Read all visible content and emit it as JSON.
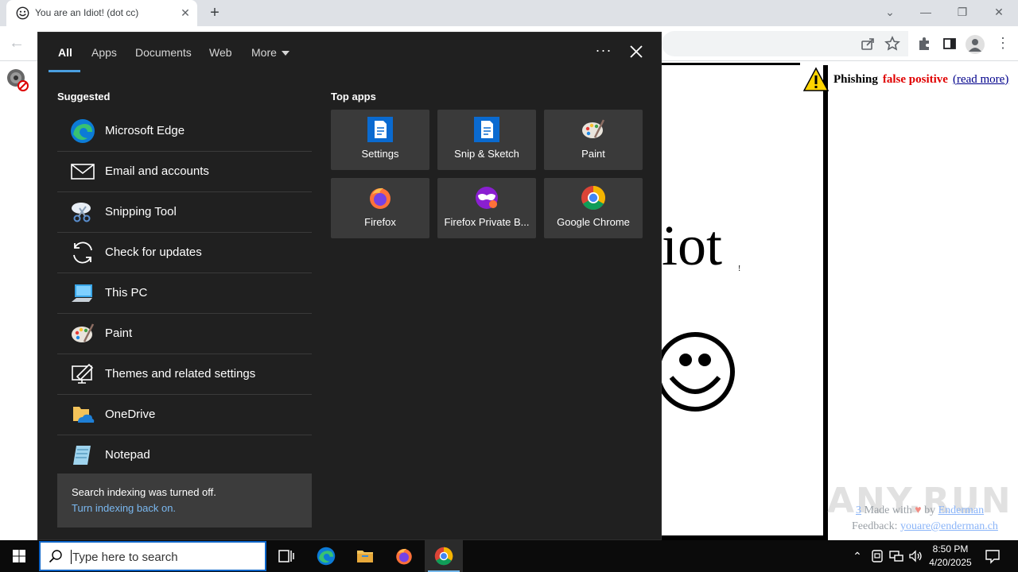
{
  "browser": {
    "tab_title": "You are an Idiot! (dot cc)",
    "new_tab": "+",
    "close_tab": "✕"
  },
  "webpage": {
    "idiot_text": "iot",
    "idiot_suffix": "!",
    "phishing_word": "Phishing",
    "false_positive": "false positive",
    "read_more": "(read more)",
    "footer_made_left": "3",
    "footer_made_with": "Made with",
    "footer_by": "by",
    "footer_author": "Enderman",
    "footer_feedback_label": "Feedback:",
    "footer_email": "youare@enderman.ch",
    "watermark": "ANY.RUN"
  },
  "search_panel": {
    "tabs": [
      {
        "label": "All"
      },
      {
        "label": "Apps"
      },
      {
        "label": "Documents"
      },
      {
        "label": "Web"
      },
      {
        "label": "More"
      }
    ],
    "more_icon": "ellipsis-icon",
    "suggested_heading": "Suggested",
    "top_apps_heading": "Top apps",
    "suggested": [
      {
        "label": "Microsoft Edge",
        "icon": "edge-icon"
      },
      {
        "label": "Email and accounts",
        "icon": "mail-icon"
      },
      {
        "label": "Snipping Tool",
        "icon": "scissors-icon"
      },
      {
        "label": "Check for updates",
        "icon": "refresh-icon"
      },
      {
        "label": "This PC",
        "icon": "computer-icon"
      },
      {
        "label": "Paint",
        "icon": "paint-palette-icon"
      },
      {
        "label": "Themes and related settings",
        "icon": "themes-icon"
      },
      {
        "label": "OneDrive",
        "icon": "onedrive-icon"
      },
      {
        "label": "Notepad",
        "icon": "notepad-icon"
      }
    ],
    "top_apps": [
      {
        "label": "Settings",
        "icon": "document-icon"
      },
      {
        "label": "Snip & Sketch",
        "icon": "document-icon"
      },
      {
        "label": "Paint",
        "icon": "paint-palette-icon"
      },
      {
        "label": "Firefox",
        "icon": "firefox-icon"
      },
      {
        "label": "Firefox Private B...",
        "icon": "firefox-private-icon"
      },
      {
        "label": "Google Chrome",
        "icon": "chrome-icon"
      }
    ],
    "notice_text": "Search indexing was turned off.",
    "notice_link": "Turn indexing back on."
  },
  "taskbar": {
    "search_placeholder": "Type here to search",
    "time": "8:50 PM",
    "date": "4/20/2025"
  },
  "colors": {
    "panel_bg": "#202020",
    "tile_bg": "#3a3a3a",
    "accent": "#4a9fe0",
    "link": "#7ab8f0",
    "taskbar_bg": "#0b0b0b",
    "phish_red": "#e00000"
  }
}
